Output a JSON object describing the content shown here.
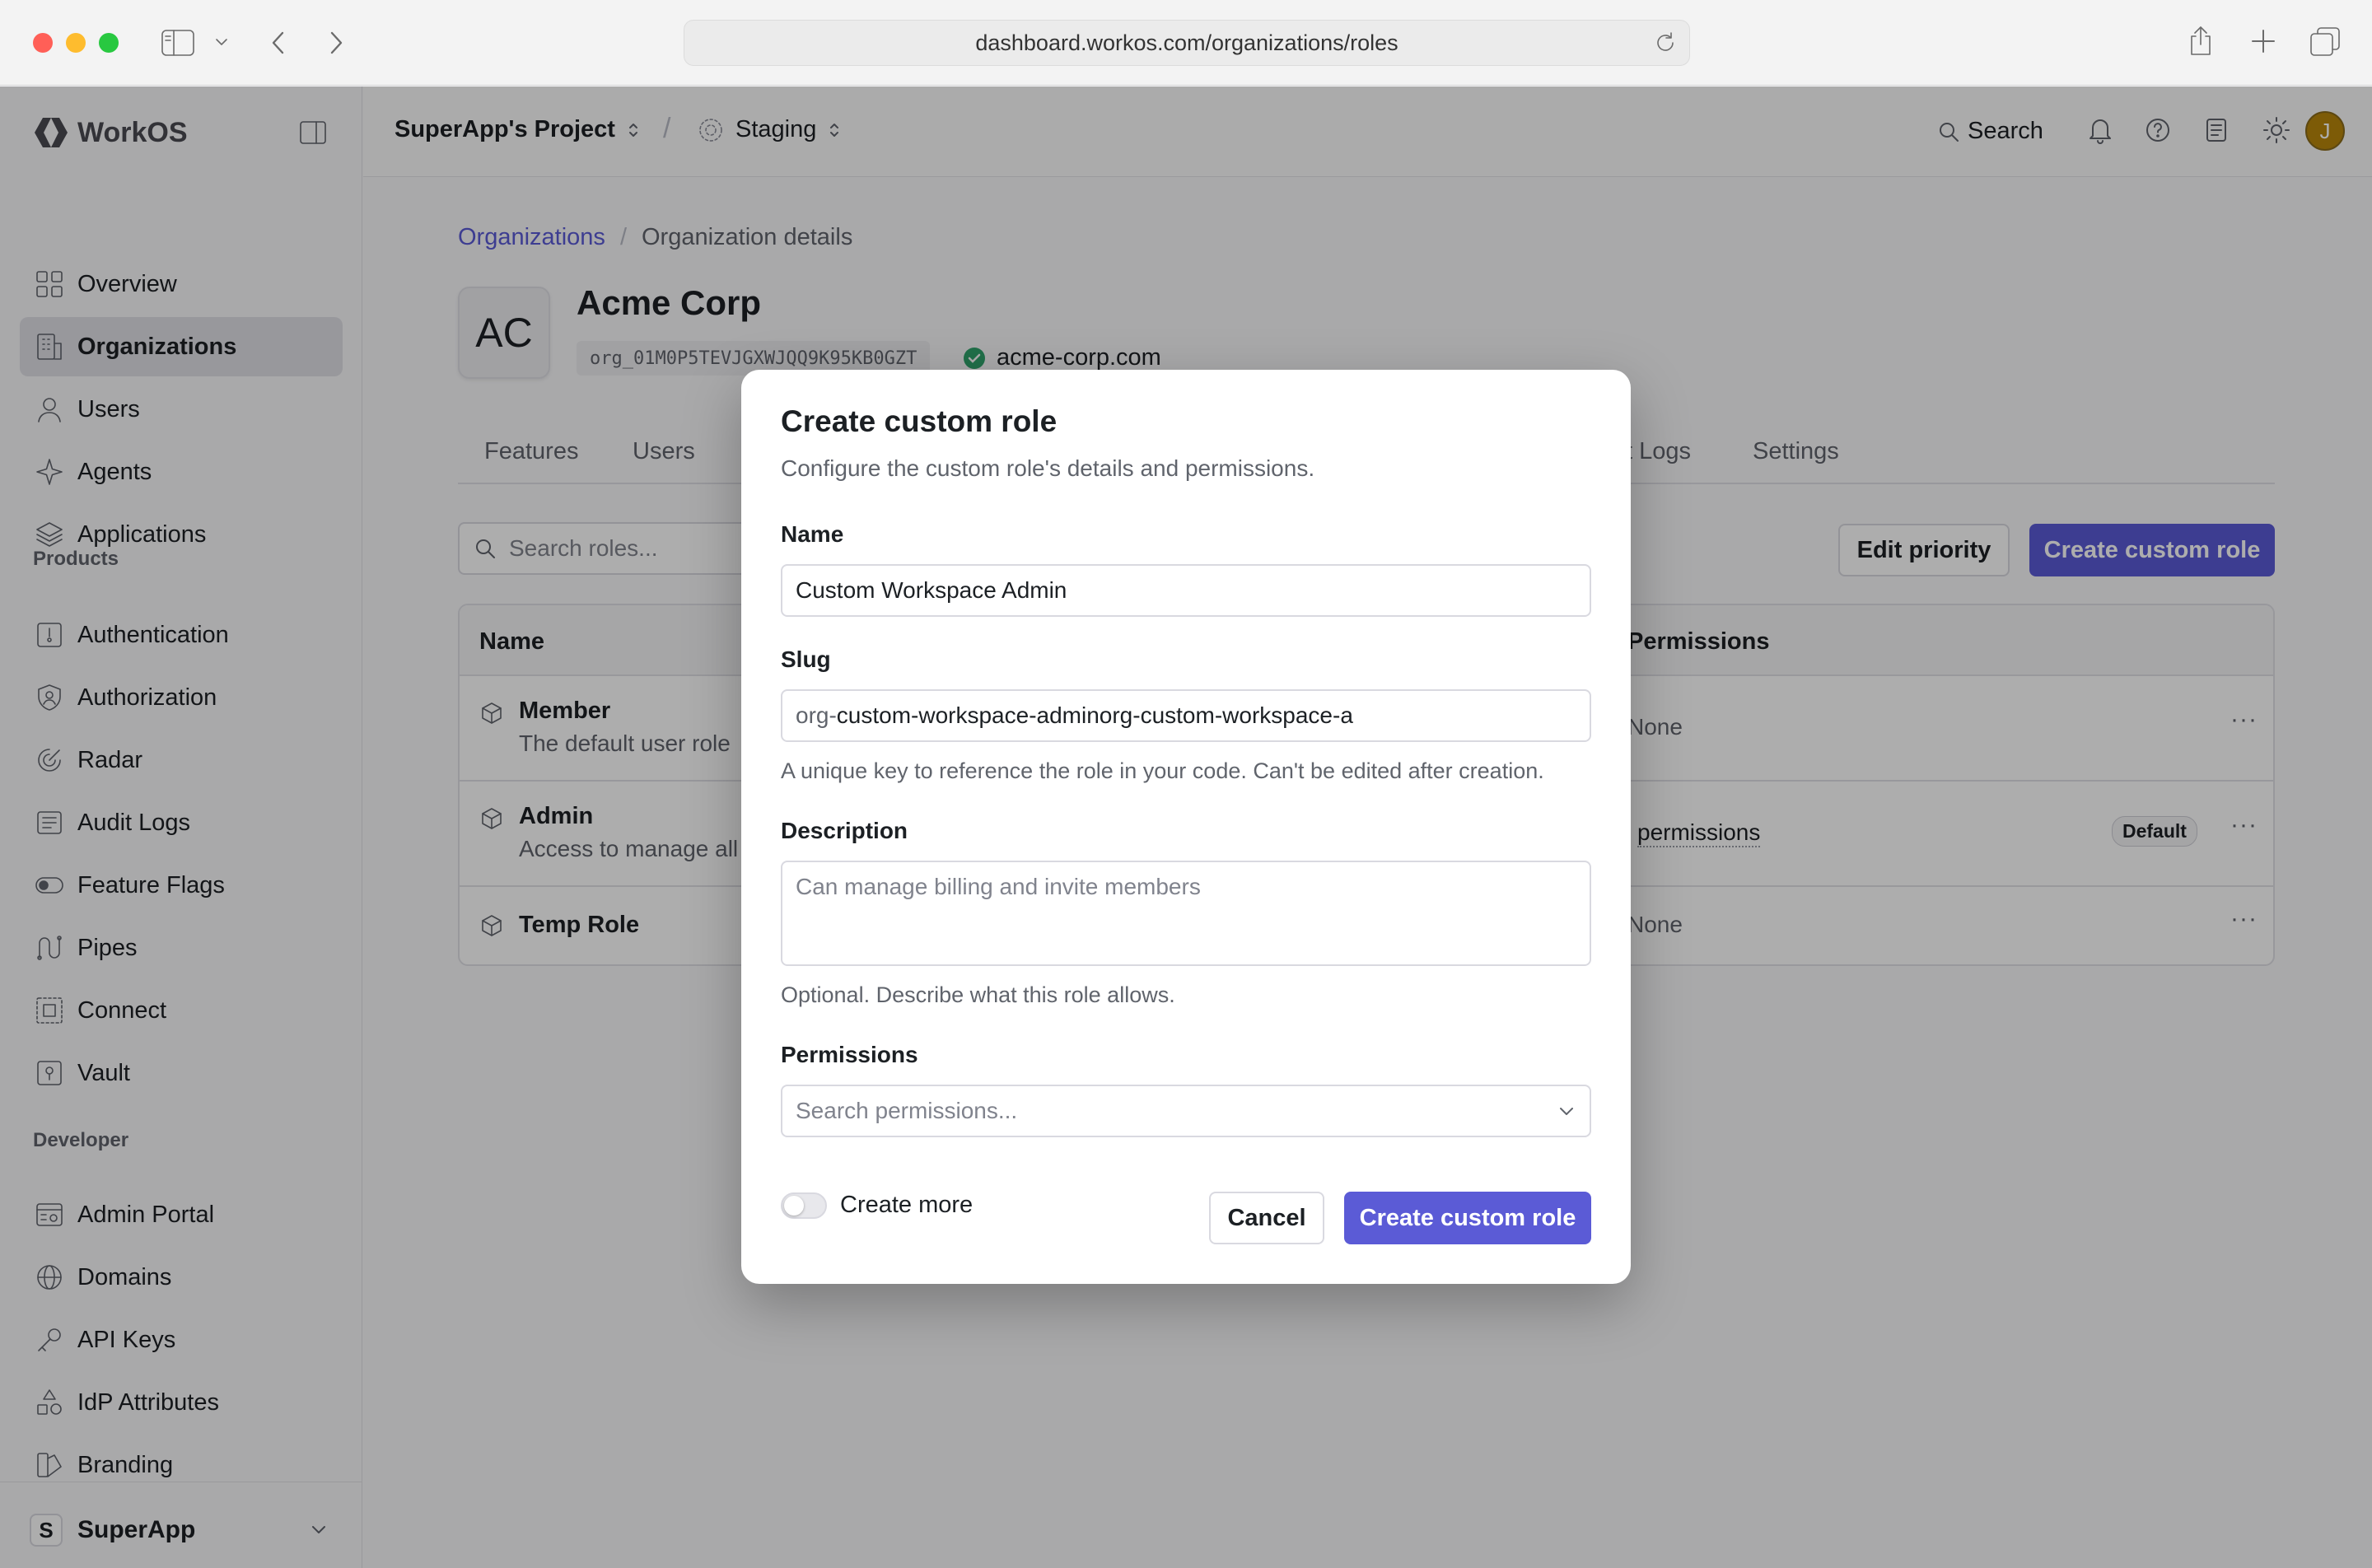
{
  "browser": {
    "url": "dashboard.workos.com/organizations/roles"
  },
  "brand": {
    "name": "WorkOS"
  },
  "topbar": {
    "project": "SuperApp's Project",
    "separator": "/",
    "environment": "Staging",
    "search_label": "Search",
    "avatar_initial": "J"
  },
  "sidebar": {
    "items_main": [
      {
        "label": "Overview",
        "icon": "grid-icon"
      },
      {
        "label": "Organizations",
        "icon": "building-icon",
        "active": true
      },
      {
        "label": "Users",
        "icon": "user-icon"
      },
      {
        "label": "Agents",
        "icon": "sparkle-icon"
      },
      {
        "label": "Applications",
        "icon": "layers-icon"
      }
    ],
    "products_label": "Products",
    "items_products": [
      {
        "label": "Authentication",
        "icon": "auth-icon"
      },
      {
        "label": "Authorization",
        "icon": "shield-icon"
      },
      {
        "label": "Radar",
        "icon": "radar-icon"
      },
      {
        "label": "Audit Logs",
        "icon": "logs-icon"
      },
      {
        "label": "Feature Flags",
        "icon": "toggle-icon"
      },
      {
        "label": "Pipes",
        "icon": "pipes-icon"
      },
      {
        "label": "Connect",
        "icon": "connect-icon"
      },
      {
        "label": "Vault",
        "icon": "vault-icon"
      }
    ],
    "developer_label": "Developer",
    "items_developer": [
      {
        "label": "Admin Portal",
        "icon": "portal-icon"
      },
      {
        "label": "Domains",
        "icon": "globe-icon"
      },
      {
        "label": "API Keys",
        "icon": "key-icon"
      },
      {
        "label": "IdP Attributes",
        "icon": "shapes-icon"
      },
      {
        "label": "Branding",
        "icon": "brush-icon"
      }
    ],
    "workspace": {
      "initial": "S",
      "name": "SuperApp"
    }
  },
  "page": {
    "breadcrumb": [
      "Organizations",
      "Organization details"
    ],
    "org_initials": "AC",
    "org_name": "Acme Corp",
    "org_id": "org_01M0P5TEVJGXWJQQ9K95KB0GZT",
    "org_domain": "acme-corp.com",
    "tabs": [
      "Features",
      "Users",
      "Audit Logs",
      "Settings"
    ],
    "search_placeholder": "Search roles...",
    "edit_priority": "Edit priority",
    "create_custom_role": "Create custom role",
    "table": {
      "headers": [
        "Name",
        "Permissions"
      ],
      "rows": [
        {
          "name": "Member",
          "desc": "The default user role",
          "permissions": "None",
          "badge": ""
        },
        {
          "name": "Admin",
          "desc": "Access to manage all",
          "permissions": "permissions",
          "badge": "Default"
        },
        {
          "name": "Temp Role",
          "desc": "",
          "permissions": "None",
          "badge": ""
        }
      ]
    }
  },
  "modal": {
    "title": "Create custom role",
    "subtitle": "Configure the custom role's details and permissions.",
    "name_label": "Name",
    "name_value": "Custom Workspace Admin",
    "slug_label": "Slug",
    "slug_prefix": "org-",
    "slug_value": "custom-workspace-adminorg-custom-workspace-a",
    "slug_hint": "A unique key to reference the role in your code. Can't be edited after creation.",
    "description_label": "Description",
    "description_placeholder": "Can manage billing and invite members",
    "description_hint": "Optional. Describe what this role allows.",
    "permissions_label": "Permissions",
    "permissions_placeholder": "Search permissions...",
    "create_more_label": "Create more",
    "cancel_label": "Cancel",
    "submit_label": "Create custom role"
  },
  "colors": {
    "accent": "#5b5bd6",
    "verified": "#30a46c"
  }
}
